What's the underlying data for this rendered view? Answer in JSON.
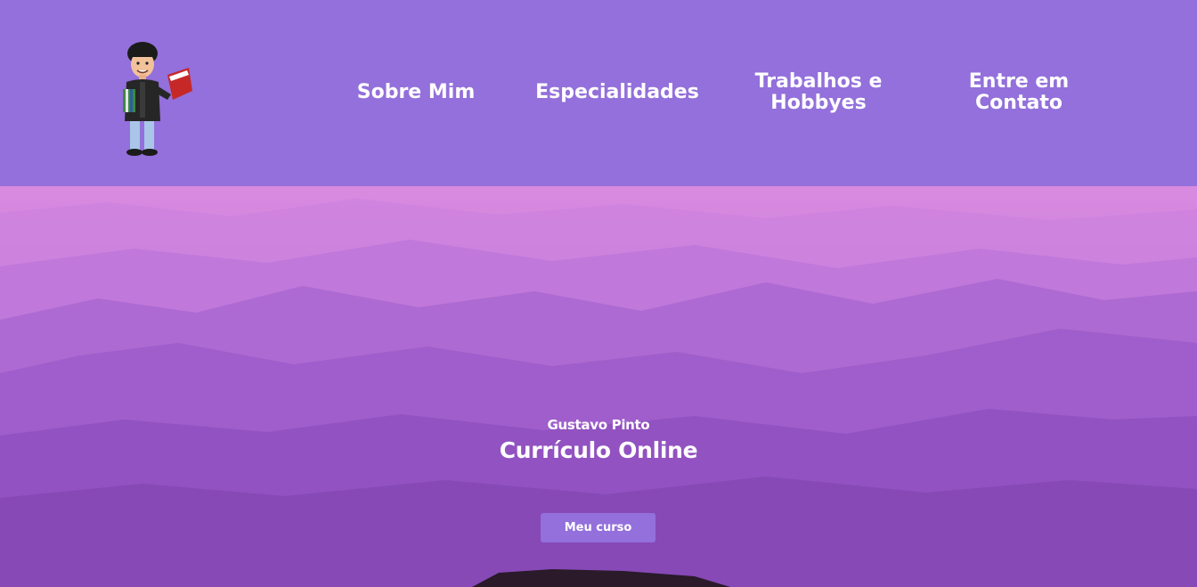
{
  "header": {
    "background": "#9370DB",
    "logo_icon": "cartoon-avatar-with-books",
    "nav": [
      {
        "label_line1": "Sobre Mim",
        "label_line2": ""
      },
      {
        "label_line1": "Especialidades",
        "label_line2": ""
      },
      {
        "label_line1": "Trabalhos e",
        "label_line2": "Hobbyes"
      },
      {
        "label_line1": "Entre em",
        "label_line2": "Contato"
      }
    ]
  },
  "hero": {
    "subtitle": "Gustavo Pinto",
    "title": "Currículo Online",
    "button_label": "Meu curso",
    "button_color": "#9370DB",
    "background_image": "purple-misty-mountains"
  }
}
